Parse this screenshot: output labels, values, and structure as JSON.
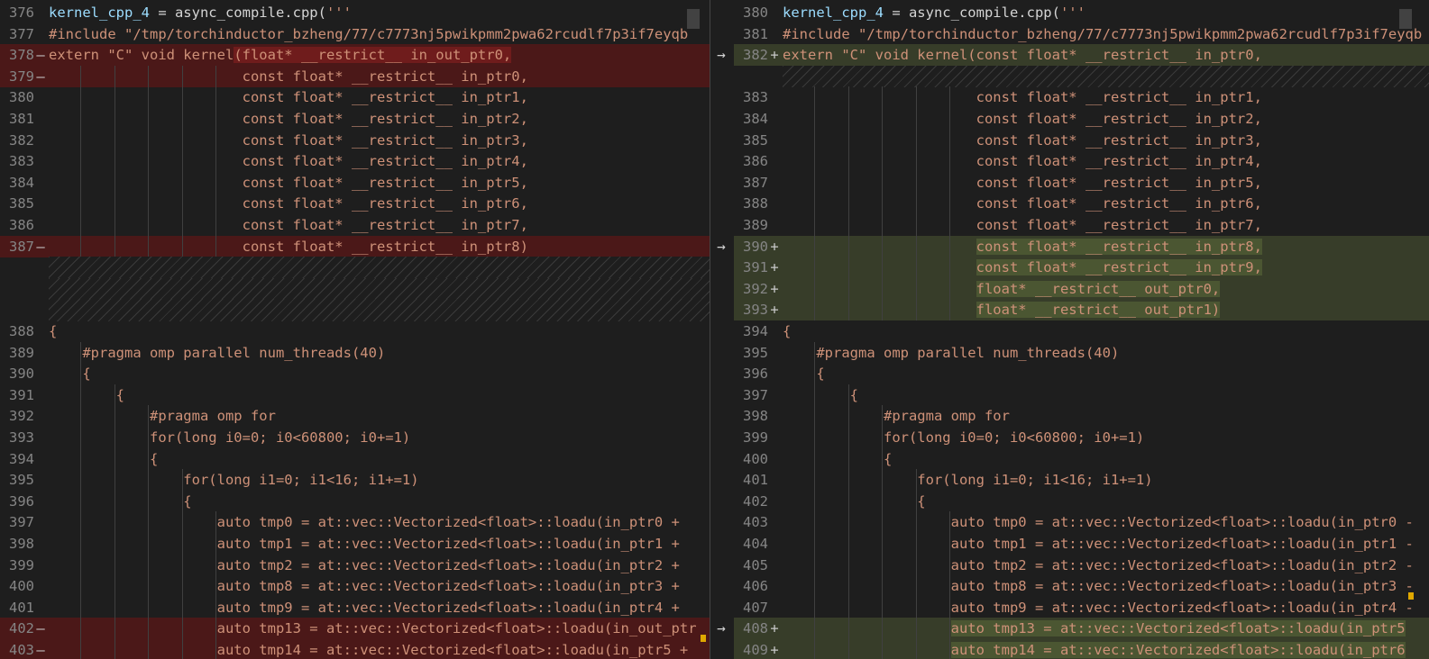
{
  "left": {
    "lines": [
      {
        "n": "376",
        "m": "",
        "t": "kernel_cpp_4 = async_compile.cpp('''",
        "type": "norm",
        "kind": "header"
      },
      {
        "n": "377",
        "m": "",
        "t": "#include \"/tmp/torchinductor_bzheng/77/c7773nj5pwikpmm2pwa62rcudlf7p3if7eyqb",
        "type": "norm",
        "kind": "include"
      },
      {
        "n": "378",
        "m": "—",
        "t": "extern \"C\" void kernel(float* __restrict__ in_out_ptr0,",
        "type": "del",
        "hl": [
          24,
          999
        ]
      },
      {
        "n": "379",
        "m": "—",
        "t": "                       const float* __restrict__ in_ptr0,",
        "type": "del"
      },
      {
        "n": "380",
        "m": "",
        "t": "                       const float* __restrict__ in_ptr1,",
        "type": "norm"
      },
      {
        "n": "381",
        "m": "",
        "t": "                       const float* __restrict__ in_ptr2,",
        "type": "norm"
      },
      {
        "n": "382",
        "m": "",
        "t": "                       const float* __restrict__ in_ptr3,",
        "type": "norm"
      },
      {
        "n": "383",
        "m": "",
        "t": "                       const float* __restrict__ in_ptr4,",
        "type": "norm"
      },
      {
        "n": "384",
        "m": "",
        "t": "                       const float* __restrict__ in_ptr5,",
        "type": "norm"
      },
      {
        "n": "385",
        "m": "",
        "t": "                       const float* __restrict__ in_ptr6,",
        "type": "norm"
      },
      {
        "n": "386",
        "m": "",
        "t": "                       const float* __restrict__ in_ptr7,",
        "type": "norm"
      },
      {
        "n": "387",
        "m": "—",
        "t": "                       const float* __restrict__ in_ptr8)",
        "type": "del"
      },
      {
        "n": "",
        "m": "",
        "t": "",
        "type": "hatch"
      },
      {
        "n": "",
        "m": "",
        "t": "",
        "type": "hatch"
      },
      {
        "n": "",
        "m": "",
        "t": "",
        "type": "hatch"
      },
      {
        "n": "388",
        "m": "",
        "t": "{",
        "type": "norm"
      },
      {
        "n": "389",
        "m": "",
        "t": "    #pragma omp parallel num_threads(40)",
        "type": "norm"
      },
      {
        "n": "390",
        "m": "",
        "t": "    {",
        "type": "norm"
      },
      {
        "n": "391",
        "m": "",
        "t": "        {",
        "type": "norm"
      },
      {
        "n": "392",
        "m": "",
        "t": "            #pragma omp for",
        "type": "norm"
      },
      {
        "n": "393",
        "m": "",
        "t": "            for(long i0=0; i0<60800; i0+=1)",
        "type": "norm"
      },
      {
        "n": "394",
        "m": "",
        "t": "            {",
        "type": "norm"
      },
      {
        "n": "395",
        "m": "",
        "t": "                for(long i1=0; i1<16; i1+=1)",
        "type": "norm"
      },
      {
        "n": "396",
        "m": "",
        "t": "                {",
        "type": "norm"
      },
      {
        "n": "397",
        "m": "",
        "t": "                    auto tmp0 = at::vec::Vectorized<float>::loadu(in_ptr0 + ",
        "type": "norm"
      },
      {
        "n": "398",
        "m": "",
        "t": "                    auto tmp1 = at::vec::Vectorized<float>::loadu(in_ptr1 + ",
        "type": "norm"
      },
      {
        "n": "399",
        "m": "",
        "t": "                    auto tmp2 = at::vec::Vectorized<float>::loadu(in_ptr2 + ",
        "type": "norm"
      },
      {
        "n": "400",
        "m": "",
        "t": "                    auto tmp8 = at::vec::Vectorized<float>::loadu(in_ptr3 + ",
        "type": "norm"
      },
      {
        "n": "401",
        "m": "",
        "t": "                    auto tmp9 = at::vec::Vectorized<float>::loadu(in_ptr4 + ",
        "type": "norm"
      },
      {
        "n": "402",
        "m": "—",
        "t": "                    auto tmp13 = at::vec::Vectorized<float>::loadu(in_out_ptr",
        "type": "del"
      },
      {
        "n": "403",
        "m": "—",
        "t": "                    auto tmp14 = at::vec::Vectorized<float>::loadu(in_ptr5 + ",
        "type": "del"
      }
    ]
  },
  "right": {
    "lines": [
      {
        "n": "380",
        "m": "",
        "t": "kernel_cpp_4 = async_compile.cpp('''",
        "type": "norm",
        "kind": "header"
      },
      {
        "n": "381",
        "m": "",
        "t": "#include \"/tmp/torchinductor_bzheng/77/c7773nj5pwikpmm2pwa62rcudlf7p3if7eyqb",
        "type": "norm",
        "kind": "include"
      },
      {
        "n": "382",
        "m": "+",
        "t": "extern \"C\" void kernel(const float* __restrict__ in_ptr0,",
        "type": "add"
      },
      {
        "n": "",
        "m": "",
        "t": "",
        "type": "hatch"
      },
      {
        "n": "383",
        "m": "",
        "t": "                       const float* __restrict__ in_ptr1,",
        "type": "norm"
      },
      {
        "n": "384",
        "m": "",
        "t": "                       const float* __restrict__ in_ptr2,",
        "type": "norm"
      },
      {
        "n": "385",
        "m": "",
        "t": "                       const float* __restrict__ in_ptr3,",
        "type": "norm"
      },
      {
        "n": "386",
        "m": "",
        "t": "                       const float* __restrict__ in_ptr4,",
        "type": "norm"
      },
      {
        "n": "387",
        "m": "",
        "t": "                       const float* __restrict__ in_ptr5,",
        "type": "norm"
      },
      {
        "n": "388",
        "m": "",
        "t": "                       const float* __restrict__ in_ptr6,",
        "type": "norm"
      },
      {
        "n": "389",
        "m": "",
        "t": "                       const float* __restrict__ in_ptr7,",
        "type": "norm"
      },
      {
        "n": "390",
        "m": "+",
        "t": "                       const float* __restrict__ in_ptr8,",
        "type": "add"
      },
      {
        "n": "391",
        "m": "+",
        "t": "                       const float* __restrict__ in_ptr9,",
        "type": "add"
      },
      {
        "n": "392",
        "m": "+",
        "t": "                       float* __restrict__ out_ptr0,",
        "type": "add"
      },
      {
        "n": "393",
        "m": "+",
        "t": "                       float* __restrict__ out_ptr1)",
        "type": "add"
      },
      {
        "n": "394",
        "m": "",
        "t": "{",
        "type": "norm"
      },
      {
        "n": "395",
        "m": "",
        "t": "    #pragma omp parallel num_threads(40)",
        "type": "norm"
      },
      {
        "n": "396",
        "m": "",
        "t": "    {",
        "type": "norm"
      },
      {
        "n": "397",
        "m": "",
        "t": "        {",
        "type": "norm"
      },
      {
        "n": "398",
        "m": "",
        "t": "            #pragma omp for",
        "type": "norm"
      },
      {
        "n": "399",
        "m": "",
        "t": "            for(long i0=0; i0<60800; i0+=1)",
        "type": "norm"
      },
      {
        "n": "400",
        "m": "",
        "t": "            {",
        "type": "norm"
      },
      {
        "n": "401",
        "m": "",
        "t": "                for(long i1=0; i1<16; i1+=1)",
        "type": "norm"
      },
      {
        "n": "402",
        "m": "",
        "t": "                {",
        "type": "norm"
      },
      {
        "n": "403",
        "m": "",
        "t": "                    auto tmp0 = at::vec::Vectorized<float>::loadu(in_ptr0 -",
        "type": "norm"
      },
      {
        "n": "404",
        "m": "",
        "t": "                    auto tmp1 = at::vec::Vectorized<float>::loadu(in_ptr1 -",
        "type": "norm"
      },
      {
        "n": "405",
        "m": "",
        "t": "                    auto tmp2 = at::vec::Vectorized<float>::loadu(in_ptr2 -",
        "type": "norm"
      },
      {
        "n": "406",
        "m": "",
        "t": "                    auto tmp8 = at::vec::Vectorized<float>::loadu(in_ptr3 -",
        "type": "norm"
      },
      {
        "n": "407",
        "m": "",
        "t": "                    auto tmp9 = at::vec::Vectorized<float>::loadu(in_ptr4 -",
        "type": "norm"
      },
      {
        "n": "408",
        "m": "+",
        "t": "                    auto tmp13 = at::vec::Vectorized<float>::loadu(in_ptr5",
        "type": "add"
      },
      {
        "n": "409",
        "m": "+",
        "t": "                    auto tmp14 = at::vec::Vectorized<float>::loadu(in_ptr6",
        "type": "add"
      }
    ]
  },
  "arrows": {
    "glyph": "→",
    "rows": [
      2,
      11,
      29
    ]
  },
  "colors": {
    "deleted_line": "#4b1818",
    "added_line": "#373d29",
    "string": "#ce9178",
    "identifier": "#9cdcfe",
    "background": "#1e1e1e",
    "line_number": "#858585"
  },
  "icons": {
    "arrow": "arrow-right-icon"
  }
}
